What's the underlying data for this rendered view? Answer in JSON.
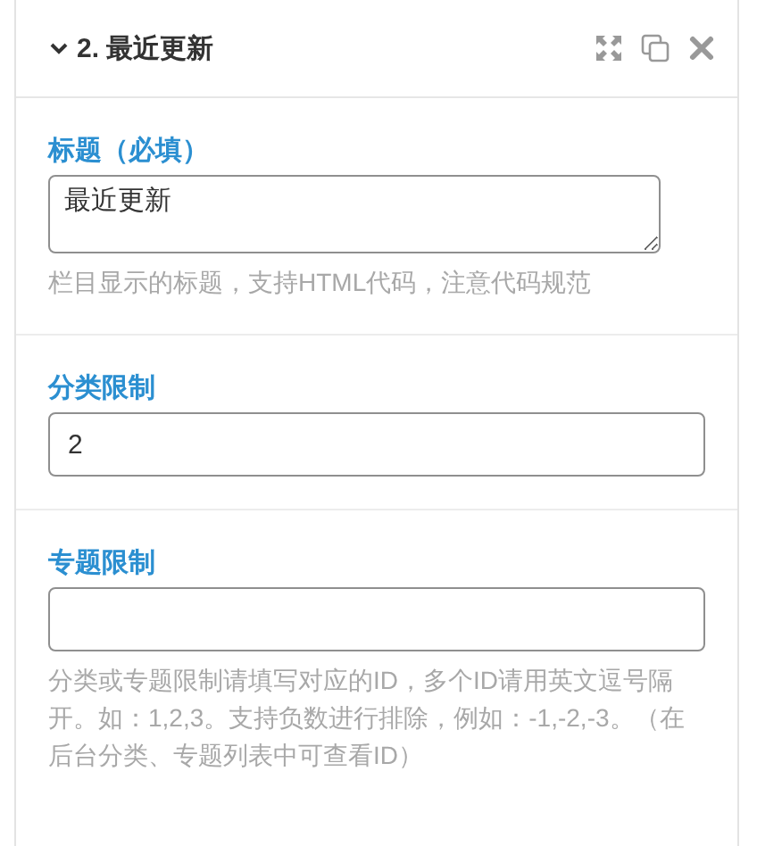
{
  "widget": {
    "title": "2. 最近更新",
    "expanded": true
  },
  "fields": [
    {
      "kind": "textarea",
      "label": "标题（必填）",
      "value": "最近更新",
      "help": "栏目显示的标题，支持HTML代码，注意代码规范"
    },
    {
      "kind": "input",
      "label": "分类限制",
      "value": "2"
    },
    {
      "kind": "input",
      "label": "专题限制",
      "help": "分类或专题限制请填写对应的ID，多个ID请用英文逗号隔开。如：1,2,3。支持负数进行排除，例如：-1,-2,-3。（在后台分类、专题列表中可查看ID）"
    }
  ]
}
